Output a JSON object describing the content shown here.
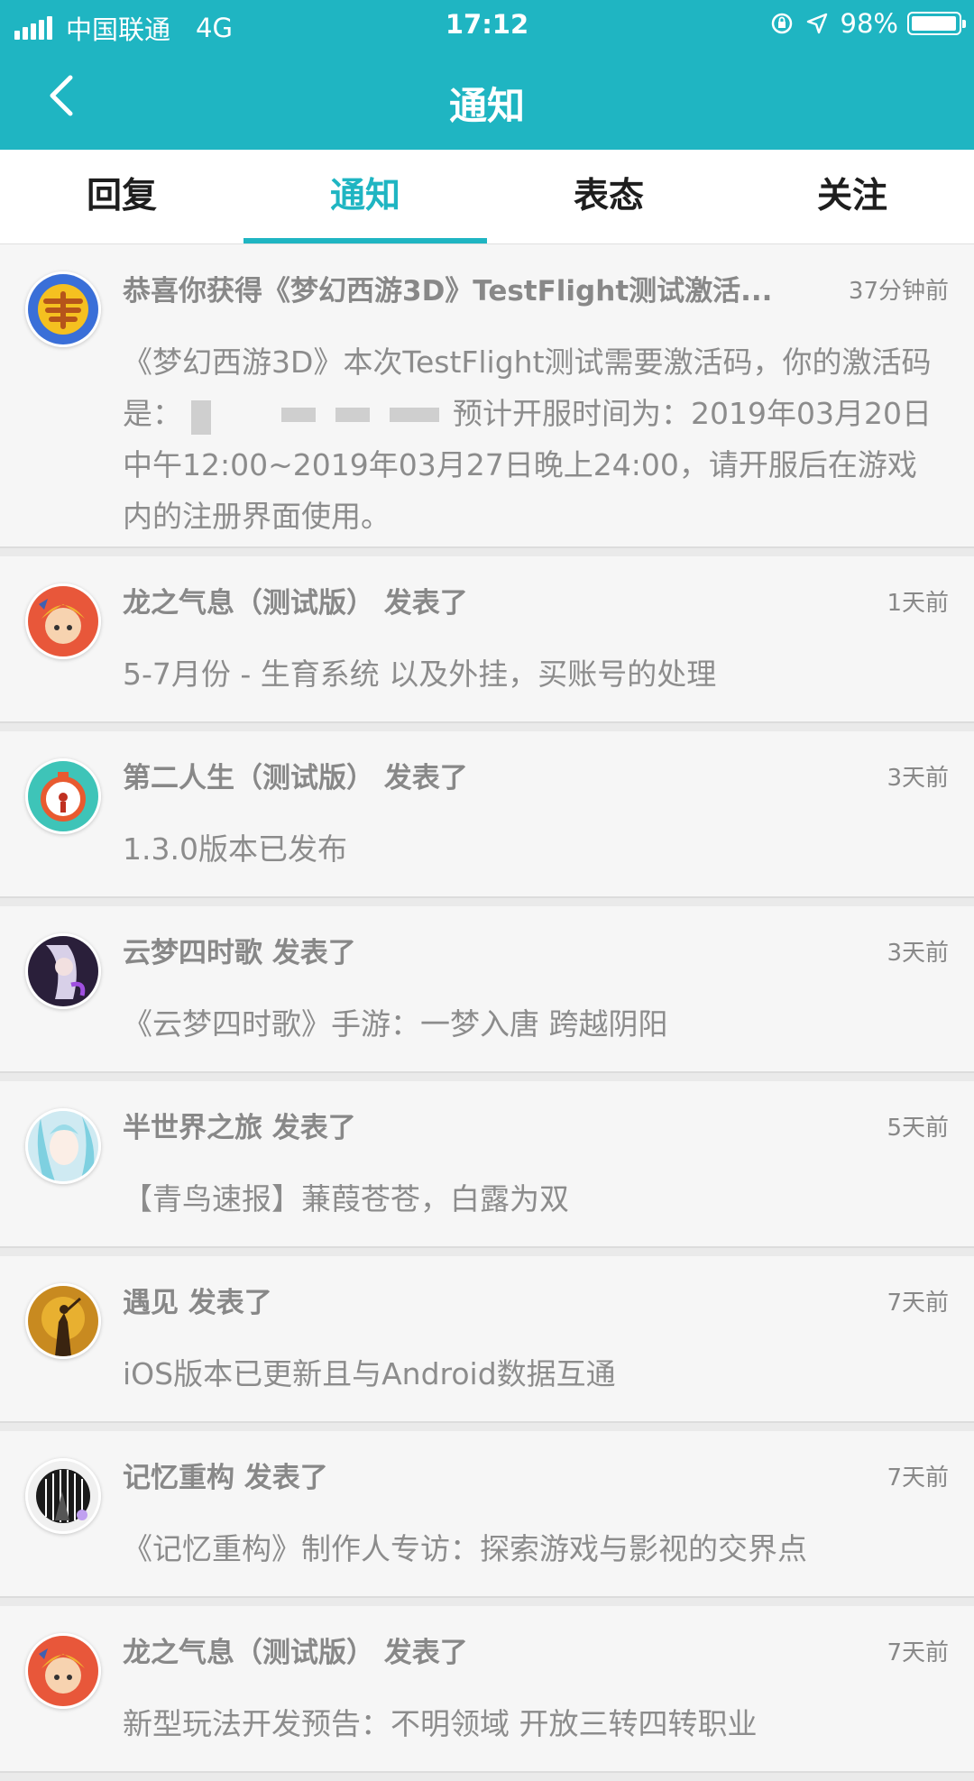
{
  "status_bar": {
    "carrier": "中国联通",
    "network": "4G",
    "time": "17:12",
    "battery": "98%",
    "battery_level": 0.98
  },
  "header": {
    "title": "通知"
  },
  "tabs": [
    {
      "label": "回复",
      "active": false
    },
    {
      "label": "通知",
      "active": true
    },
    {
      "label": "表态",
      "active": false
    },
    {
      "label": "关注",
      "active": false
    }
  ],
  "colors": {
    "accent": "#1fb5c2",
    "text_muted": "#8c8c8c"
  },
  "notifications": [
    {
      "title": "恭喜你获得《梦幻西游3D》TestFlight测试激活...",
      "time": "37分钟前",
      "body_pre": "《梦幻西游3D》本次TestFlight测试需要激活码，你的激活码是：",
      "body_post": "预计开服时间为：2019年03月20日中午12:00~2019年03月27日晚上24:00，请开服后在游戏内的注册界面使用。",
      "avatar_icon": "menghuan-game-icon"
    },
    {
      "title": "龙之气息（测试版） 发表了",
      "time": "1天前",
      "body": "5-7月份 - 生育系统 以及外挂，买账号的处理",
      "avatar_icon": "dragon-game-icon"
    },
    {
      "title": "第二人生（测试版） 发表了",
      "time": "3天前",
      "body": "1.3.0版本已发布",
      "avatar_icon": "second-life-game-icon"
    },
    {
      "title": "云梦四时歌 发表了",
      "time": "3天前",
      "body": "《云梦四时歌》手游：一梦入唐 跨越阴阳",
      "avatar_icon": "yunmeng-game-icon"
    },
    {
      "title": "半世界之旅 发表了",
      "time": "5天前",
      "body": "【青鸟速报】蒹葭苍苍，白露为双",
      "avatar_icon": "half-world-game-icon"
    },
    {
      "title": "遇见 发表了",
      "time": "7天前",
      "body": "iOS版本已更新且与Android数据互通",
      "avatar_icon": "meet-game-icon"
    },
    {
      "title": "记忆重构 发表了",
      "time": "7天前",
      "body": "《记忆重构》制作人专访：探索游戏与影视的交界点",
      "avatar_icon": "memory-game-icon"
    },
    {
      "title": "龙之气息（测试版） 发表了",
      "time": "7天前",
      "body": "新型玩法开发预告：不明领域 开放三转四转职业",
      "avatar_icon": "dragon-game-icon"
    }
  ]
}
